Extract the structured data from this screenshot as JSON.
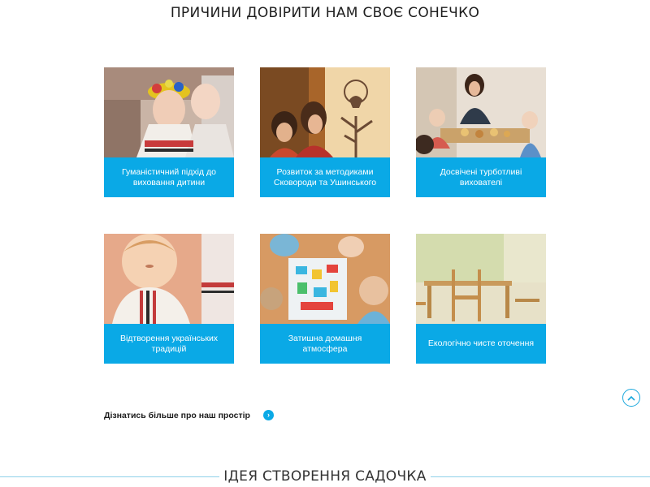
{
  "header": {
    "title": "Причини довірити нам своє сонечко"
  },
  "colors": {
    "accent": "#0aa9e6",
    "divider": "#8fd0ea"
  },
  "cards": [
    {
      "caption": "Гуманістичний підхід до виховання дитини",
      "image": "children-hugging-photo"
    },
    {
      "caption": "Розвиток за методиками Сковороди та Ушинського",
      "image": "shadow-theater-photo"
    },
    {
      "caption": "Досвічені турботливі вихователі",
      "image": "teacher-with-kids-photo"
    },
    {
      "caption": "Відтворення українських традицій",
      "image": "toddler-embroidered-shirt-photo"
    },
    {
      "caption": "Затишна домашня атмосфера",
      "image": "kids-playing-floor-photo"
    },
    {
      "caption": "Екологічно чисте оточення",
      "image": "wooden-furniture-room-photo"
    }
  ],
  "more_link": {
    "label": "Дізнатись більше про наш простір",
    "icon": "chevron-right-icon"
  },
  "scroll_top": {
    "icon": "chevron-up-icon"
  },
  "next_section": {
    "title": "Ідея створення садочка"
  }
}
